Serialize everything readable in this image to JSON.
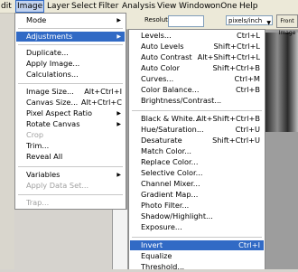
{
  "menubar": {
    "items": [
      "dit",
      "Image",
      "Layer",
      "Select",
      "Filter",
      "Analysis",
      "View",
      "Window",
      "onOne",
      "Help"
    ]
  },
  "options": {
    "resolution_label": "Resolution:",
    "unit_value": "pixels/inch",
    "front_button": "Front Image"
  },
  "image_menu": {
    "items": [
      {
        "label": "Mode",
        "shortcut": "",
        "submenu": true,
        "disabled": false,
        "highlighted": false
      },
      {
        "label": "Adjustments",
        "shortcut": "",
        "submenu": true,
        "disabled": false,
        "highlighted": true
      },
      {
        "label": "Duplicate...",
        "shortcut": "",
        "submenu": false,
        "disabled": false,
        "highlighted": false
      },
      {
        "label": "Apply Image...",
        "shortcut": "",
        "submenu": false,
        "disabled": false,
        "highlighted": false
      },
      {
        "label": "Calculations...",
        "shortcut": "",
        "submenu": false,
        "disabled": false,
        "highlighted": false
      },
      {
        "label": "Image Size...",
        "shortcut": "Alt+Ctrl+I",
        "submenu": false,
        "disabled": false,
        "highlighted": false
      },
      {
        "label": "Canvas Size...",
        "shortcut": "Alt+Ctrl+C",
        "submenu": false,
        "disabled": false,
        "highlighted": false
      },
      {
        "label": "Pixel Aspect Ratio",
        "shortcut": "",
        "submenu": true,
        "disabled": false,
        "highlighted": false
      },
      {
        "label": "Rotate Canvas",
        "shortcut": "",
        "submenu": true,
        "disabled": false,
        "highlighted": false
      },
      {
        "label": "Crop",
        "shortcut": "",
        "submenu": false,
        "disabled": true,
        "highlighted": false
      },
      {
        "label": "Trim...",
        "shortcut": "",
        "submenu": false,
        "disabled": false,
        "highlighted": false
      },
      {
        "label": "Reveal All",
        "shortcut": "",
        "submenu": false,
        "disabled": false,
        "highlighted": false
      },
      {
        "label": "Variables",
        "shortcut": "",
        "submenu": true,
        "disabled": false,
        "highlighted": false
      },
      {
        "label": "Apply Data Set...",
        "shortcut": "",
        "submenu": false,
        "disabled": true,
        "highlighted": false
      },
      {
        "label": "Trap...",
        "shortcut": "",
        "submenu": false,
        "disabled": true,
        "highlighted": false
      }
    ]
  },
  "adjustments_menu": {
    "items": [
      {
        "label": "Levels...",
        "shortcut": "Ctrl+L",
        "highlighted": false
      },
      {
        "label": "Auto Levels",
        "shortcut": "Shift+Ctrl+L",
        "highlighted": false
      },
      {
        "label": "Auto Contrast",
        "shortcut": "Alt+Shift+Ctrl+L",
        "highlighted": false
      },
      {
        "label": "Auto Color",
        "shortcut": "Shift+Ctrl+B",
        "highlighted": false
      },
      {
        "label": "Curves...",
        "shortcut": "Ctrl+M",
        "highlighted": false
      },
      {
        "label": "Color Balance...",
        "shortcut": "Ctrl+B",
        "highlighted": false
      },
      {
        "label": "Brightness/Contrast...",
        "shortcut": "",
        "highlighted": false
      },
      {
        "label": "Black & White...",
        "shortcut": "Alt+Shift+Ctrl+B",
        "highlighted": false
      },
      {
        "label": "Hue/Saturation...",
        "shortcut": "Ctrl+U",
        "highlighted": false
      },
      {
        "label": "Desaturate",
        "shortcut": "Shift+Ctrl+U",
        "highlighted": false
      },
      {
        "label": "Match Color...",
        "shortcut": "",
        "highlighted": false
      },
      {
        "label": "Replace Color...",
        "shortcut": "",
        "highlighted": false
      },
      {
        "label": "Selective Color...",
        "shortcut": "",
        "highlighted": false
      },
      {
        "label": "Channel Mixer...",
        "shortcut": "",
        "highlighted": false
      },
      {
        "label": "Gradient Map...",
        "shortcut": "",
        "highlighted": false
      },
      {
        "label": "Photo Filter...",
        "shortcut": "",
        "highlighted": false
      },
      {
        "label": "Shadow/Highlight...",
        "shortcut": "",
        "highlighted": false
      },
      {
        "label": "Exposure...",
        "shortcut": "",
        "highlighted": false
      },
      {
        "label": "Invert",
        "shortcut": "Ctrl+I",
        "highlighted": true
      },
      {
        "label": "Equalize",
        "shortcut": "",
        "highlighted": false
      },
      {
        "label": "Threshold...",
        "shortcut": "",
        "highlighted": false
      }
    ]
  },
  "colors": {
    "highlight": "#316ac5",
    "disabled_text": "#a0a0a0"
  }
}
